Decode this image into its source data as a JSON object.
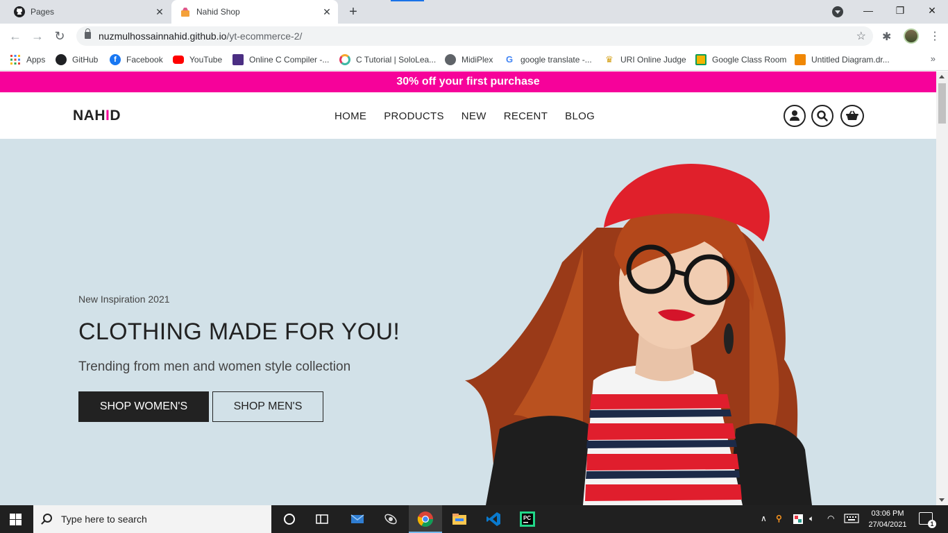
{
  "browser": {
    "tabs": [
      {
        "title": "Pages",
        "icon": "github-icon",
        "active": false
      },
      {
        "title": "Nahid Shop",
        "icon": "shop-favicon",
        "active": true
      }
    ],
    "url_host": "nuzmulhossainnahid.github.io",
    "url_path": "/yt-ecommerce-2/",
    "bookmarks": [
      {
        "label": "Apps",
        "icon": "apps-grid-icon"
      },
      {
        "label": "GitHub",
        "icon": "github-icon"
      },
      {
        "label": "Facebook",
        "icon": "facebook-icon"
      },
      {
        "label": "YouTube",
        "icon": "youtube-icon"
      },
      {
        "label": "Online C Compiler -...",
        "icon": "compiler-icon"
      },
      {
        "label": "C Tutorial | SoloLea...",
        "icon": "sololearn-icon"
      },
      {
        "label": "MidiPlex",
        "icon": "globe-icon"
      },
      {
        "label": "google translate -...",
        "icon": "google-icon"
      },
      {
        "label": "URI Online Judge",
        "icon": "trophy-icon"
      },
      {
        "label": "Google Class Room",
        "icon": "classroom-icon"
      },
      {
        "label": "Untitled Diagram.dr...",
        "icon": "drawio-icon"
      }
    ],
    "bookmarks_more": "»"
  },
  "page": {
    "promo": "30% off your first purchase",
    "logo_prefix": "NAH",
    "logo_highlight": "I",
    "logo_suffix": "D",
    "nav": [
      "HOME",
      "PRODUCTS",
      "NEW",
      "RECENT",
      "BLOG"
    ],
    "nav_icons": [
      "user-icon",
      "search-icon",
      "basket-icon"
    ],
    "hero": {
      "subtitle": "New Inspiration 2021",
      "title": "CLOTHING MADE FOR YOU!",
      "lead": "Trending from men and women style collection",
      "btn_women": "SHOP WOMEN'S",
      "btn_men": "SHOP MEN'S"
    },
    "colors": {
      "accent": "#f6029a",
      "hero_bg": "#d2e1e8",
      "dark": "#222222"
    }
  },
  "taskbar": {
    "search_placeholder": "Type here to search",
    "time": "03:06 PM",
    "date": "27/04/2021",
    "notification_count": "1"
  }
}
